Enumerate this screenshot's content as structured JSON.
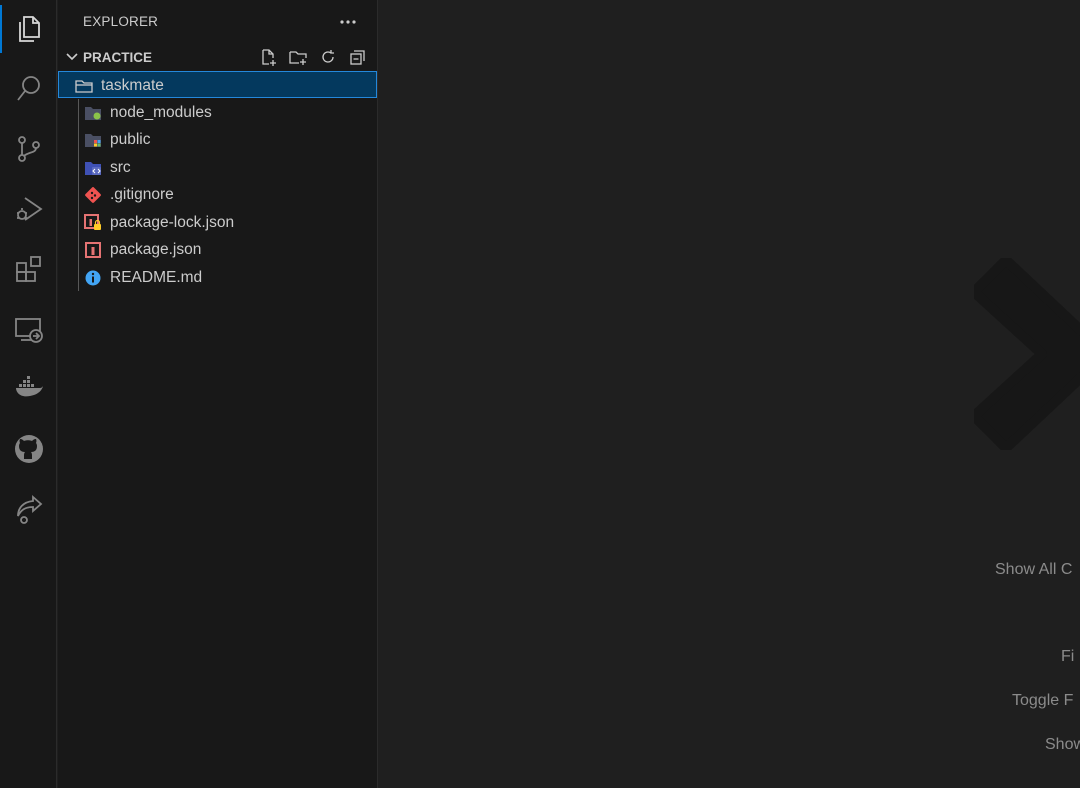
{
  "sidebar": {
    "title": "EXPLORER",
    "more_label": "···",
    "section": {
      "title": "PRACTICE",
      "actions": [
        "new-file",
        "new-folder",
        "refresh",
        "collapse-all"
      ]
    },
    "tree": [
      {
        "label": "taskmate",
        "icon": "folder-open-icon",
        "selected": true
      },
      {
        "label": "node_modules",
        "icon": "node-modules-folder-icon"
      },
      {
        "label": "public",
        "icon": "public-folder-icon"
      },
      {
        "label": "src",
        "icon": "src-folder-icon"
      },
      {
        "label": ".gitignore",
        "icon": "git-icon"
      },
      {
        "label": "package-lock.json",
        "icon": "npm-lock-icon"
      },
      {
        "label": "package.json",
        "icon": "npm-icon"
      },
      {
        "label": "README.md",
        "icon": "info-icon"
      }
    ]
  },
  "activity_bar": {
    "items": [
      "explorer-icon",
      "search-icon",
      "source-control-icon",
      "run-debug-icon",
      "extensions-icon",
      "remote-explorer-icon",
      "docker-icon",
      "github-icon",
      "live-share-icon"
    ]
  },
  "editor": {
    "hints": {
      "show_all": "Show All C",
      "find": "Fi",
      "toggle": "Toggle F",
      "show": "Show"
    }
  },
  "colors": {
    "accent": "#0078d4",
    "selection_bg": "#04395e",
    "selection_border": "#2488db",
    "sidebar_bg": "#181818",
    "editor_bg": "#1f1f1f"
  }
}
